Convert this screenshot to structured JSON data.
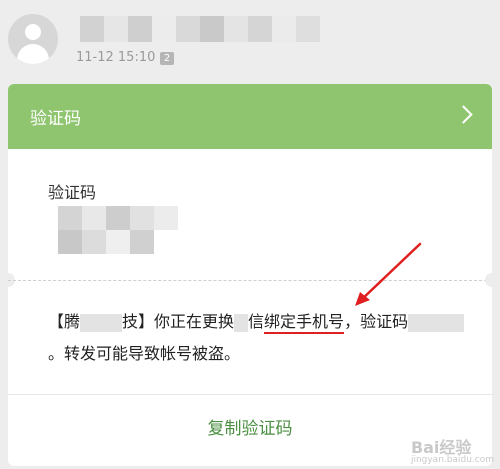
{
  "message_meta": {
    "timestamp": "11-12 15:10",
    "count_badge": "2"
  },
  "card": {
    "title": "验证码",
    "code_label": "验证码",
    "message_part1": "【腾",
    "message_part2": "技】你正在更换",
    "message_part3": "信",
    "message_highlight": "绑定手机号",
    "message_part4": "，验证码",
    "message_part5": "。转发可能导致帐号被盗。",
    "copy_button": "复制验证码"
  },
  "colors": {
    "header_green": "#8fc56f",
    "button_green": "#4a8f42",
    "annotation_red": "#e02020"
  },
  "watermark": {
    "text": "Bai经验",
    "sub": "jingyan.baidu.com"
  }
}
